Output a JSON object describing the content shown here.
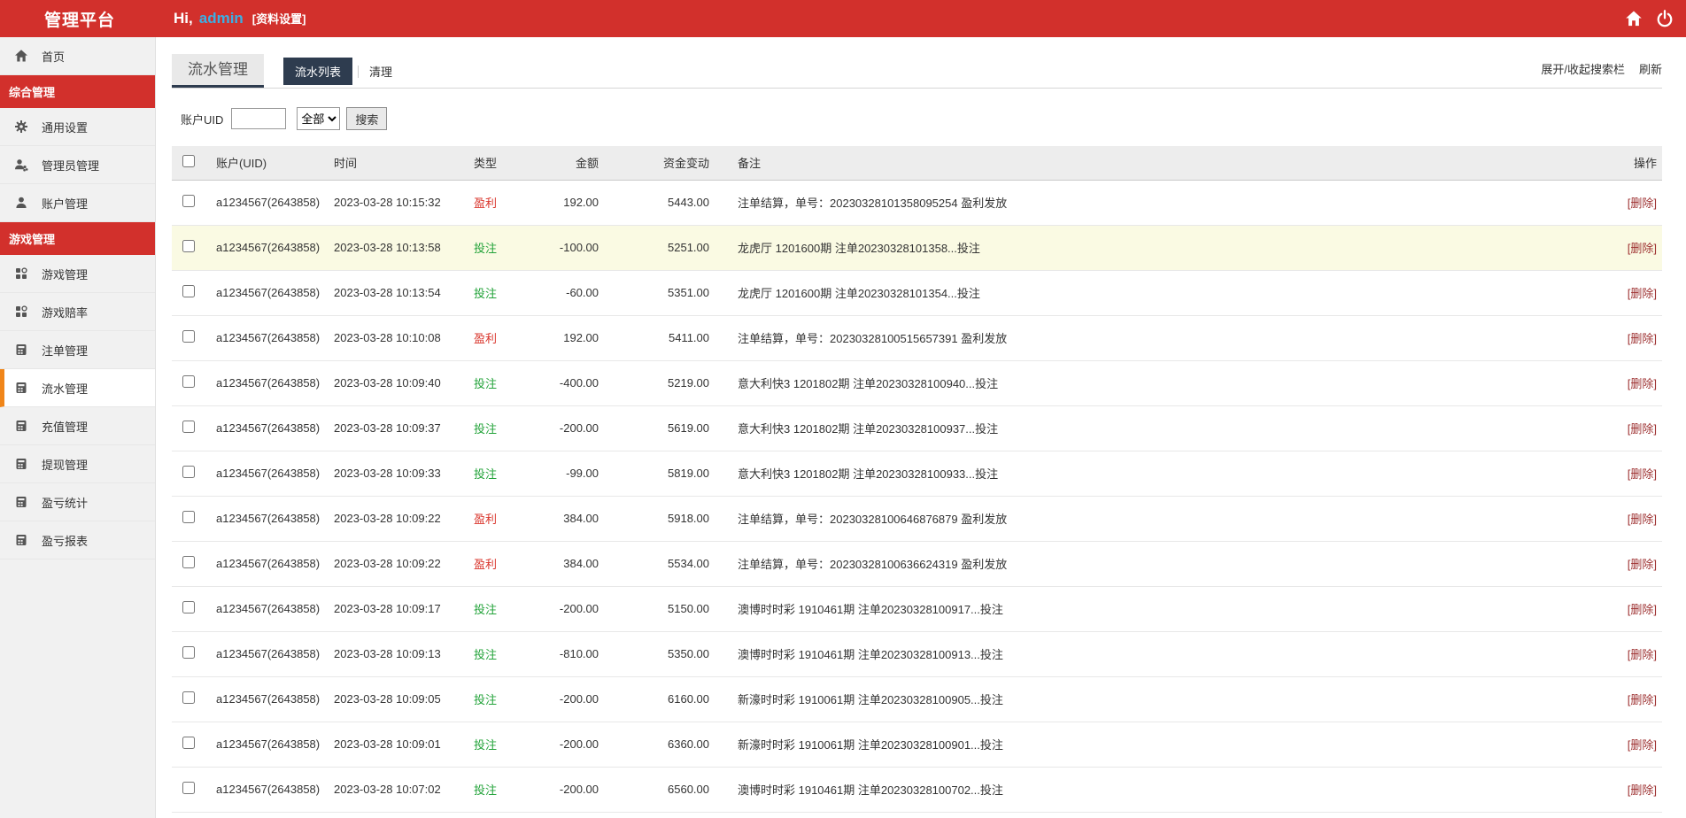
{
  "palette": {
    "brand_red": "#d2302c",
    "navy": "#2e3c4f",
    "active_item_orange": "#f08519",
    "profit_red": "#d9342b",
    "bet_green": "#23a33a",
    "highlight_row": "#fafae3",
    "admin_blue": "#3caee3"
  },
  "header": {
    "brand": "管理平台",
    "greeting_prefix": "Hi,",
    "username": "admin",
    "profile_link": "[资料设置]",
    "icons": [
      "home-icon",
      "power-icon"
    ]
  },
  "sidebar": {
    "items": [
      {
        "label": "首页",
        "type": "item",
        "icon": "home",
        "active": false
      },
      {
        "label": "综合管理",
        "type": "section"
      },
      {
        "label": "通用设置",
        "type": "item",
        "icon": "gear",
        "active": false
      },
      {
        "label": "管理员管理",
        "type": "item",
        "icon": "users",
        "active": false
      },
      {
        "label": "账户管理",
        "type": "item",
        "icon": "user",
        "active": false
      },
      {
        "label": "游戏管理",
        "type": "section"
      },
      {
        "label": "游戏管理",
        "type": "item",
        "icon": "grid",
        "active": false
      },
      {
        "label": "游戏赔率",
        "type": "item",
        "icon": "grid",
        "active": false
      },
      {
        "label": "注单管理",
        "type": "item",
        "icon": "form",
        "active": false
      },
      {
        "label": "流水管理",
        "type": "item",
        "icon": "form",
        "active": true
      },
      {
        "label": "充值管理",
        "type": "item",
        "icon": "form",
        "active": false
      },
      {
        "label": "提现管理",
        "type": "item",
        "icon": "form",
        "active": false
      },
      {
        "label": "盈亏统计",
        "type": "item",
        "icon": "form",
        "active": false
      },
      {
        "label": "盈亏报表",
        "type": "item",
        "icon": "form",
        "active": false
      }
    ]
  },
  "content": {
    "page_tab": "流水管理",
    "tabs": [
      {
        "label": "流水列表",
        "active": true
      },
      {
        "label": "清理",
        "active": false
      }
    ],
    "toolbar_links": [
      "展开/收起搜索栏",
      "刷新"
    ],
    "search": {
      "label": "账户UID",
      "input_value": "",
      "select_value": "全部",
      "button": "搜索"
    },
    "table": {
      "columns": [
        "账户(UID)",
        "时间",
        "类型",
        "金额",
        "资金变动",
        "备注",
        "操作"
      ],
      "delete_label": "[删除]",
      "rows": [
        {
          "uid": "a1234567(2643858)",
          "time": "2023-03-28 10:15:32",
          "type": "盈利",
          "type_class": "profit",
          "amount": "192.00",
          "balance": "5443.00",
          "remark": "注单结算，单号：20230328101358095254 盈利发放",
          "highlighted": false
        },
        {
          "uid": "a1234567(2643858)",
          "time": "2023-03-28 10:13:58",
          "type": "投注",
          "type_class": "bet",
          "amount": "-100.00",
          "balance": "5251.00",
          "remark": "龙虎厅 1201600期 注单20230328101358...投注",
          "highlighted": true
        },
        {
          "uid": "a1234567(2643858)",
          "time": "2023-03-28 10:13:54",
          "type": "投注",
          "type_class": "bet",
          "amount": "-60.00",
          "balance": "5351.00",
          "remark": "龙虎厅 1201600期 注单20230328101354...投注",
          "highlighted": false
        },
        {
          "uid": "a1234567(2643858)",
          "time": "2023-03-28 10:10:08",
          "type": "盈利",
          "type_class": "profit",
          "amount": "192.00",
          "balance": "5411.00",
          "remark": "注单结算，单号：20230328100515657391 盈利发放",
          "highlighted": false
        },
        {
          "uid": "a1234567(2643858)",
          "time": "2023-03-28 10:09:40",
          "type": "投注",
          "type_class": "bet",
          "amount": "-400.00",
          "balance": "5219.00",
          "remark": "意大利快3 1201802期 注单20230328100940...投注",
          "highlighted": false
        },
        {
          "uid": "a1234567(2643858)",
          "time": "2023-03-28 10:09:37",
          "type": "投注",
          "type_class": "bet",
          "amount": "-200.00",
          "balance": "5619.00",
          "remark": "意大利快3 1201802期 注单20230328100937...投注",
          "highlighted": false
        },
        {
          "uid": "a1234567(2643858)",
          "time": "2023-03-28 10:09:33",
          "type": "投注",
          "type_class": "bet",
          "amount": "-99.00",
          "balance": "5819.00",
          "remark": "意大利快3 1201802期 注单20230328100933...投注",
          "highlighted": false
        },
        {
          "uid": "a1234567(2643858)",
          "time": "2023-03-28 10:09:22",
          "type": "盈利",
          "type_class": "profit",
          "amount": "384.00",
          "balance": "5918.00",
          "remark": "注单结算，单号：20230328100646876879 盈利发放",
          "highlighted": false
        },
        {
          "uid": "a1234567(2643858)",
          "time": "2023-03-28 10:09:22",
          "type": "盈利",
          "type_class": "profit",
          "amount": "384.00",
          "balance": "5534.00",
          "remark": "注单结算，单号：20230328100636624319 盈利发放",
          "highlighted": false
        },
        {
          "uid": "a1234567(2643858)",
          "time": "2023-03-28 10:09:17",
          "type": "投注",
          "type_class": "bet",
          "amount": "-200.00",
          "balance": "5150.00",
          "remark": "澳博时时彩 1910461期 注单20230328100917...投注",
          "highlighted": false
        },
        {
          "uid": "a1234567(2643858)",
          "time": "2023-03-28 10:09:13",
          "type": "投注",
          "type_class": "bet",
          "amount": "-810.00",
          "balance": "5350.00",
          "remark": "澳博时时彩 1910461期 注单20230328100913...投注",
          "highlighted": false
        },
        {
          "uid": "a1234567(2643858)",
          "time": "2023-03-28 10:09:05",
          "type": "投注",
          "type_class": "bet",
          "amount": "-200.00",
          "balance": "6160.00",
          "remark": "新濠时时彩 1910061期 注单20230328100905...投注",
          "highlighted": false
        },
        {
          "uid": "a1234567(2643858)",
          "time": "2023-03-28 10:09:01",
          "type": "投注",
          "type_class": "bet",
          "amount": "-200.00",
          "balance": "6360.00",
          "remark": "新濠时时彩 1910061期 注单20230328100901...投注",
          "highlighted": false
        },
        {
          "uid": "a1234567(2643858)",
          "time": "2023-03-28 10:07:02",
          "type": "投注",
          "type_class": "bet",
          "amount": "-200.00",
          "balance": "6560.00",
          "remark": "澳博时时彩 1910461期 注单20230328100702...投注",
          "highlighted": false
        }
      ]
    }
  }
}
